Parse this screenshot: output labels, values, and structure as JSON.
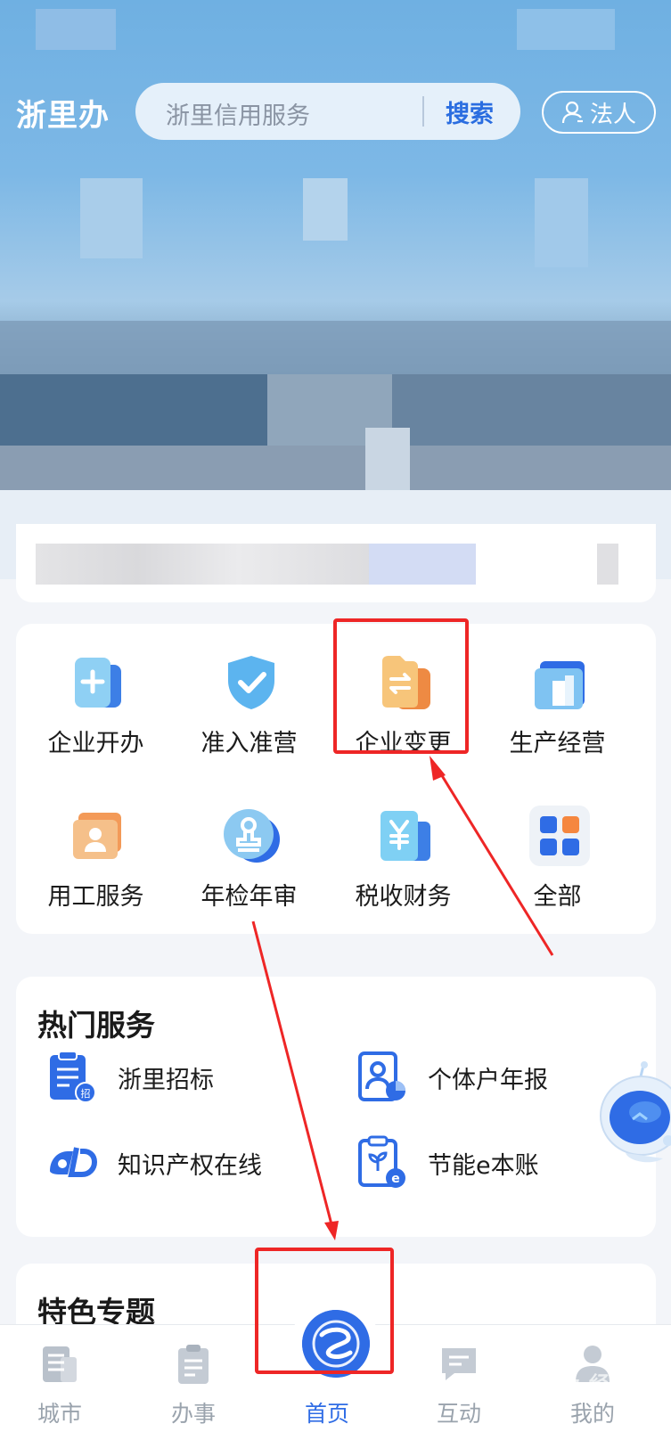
{
  "header": {
    "app_title": "浙里办",
    "search_placeholder": "浙里信用服务",
    "search_button": "搜索",
    "role_button": "法人"
  },
  "services_grid": [
    {
      "label": "企业开办",
      "icon": "enterprise-open-icon"
    },
    {
      "label": "准入准营",
      "icon": "shield-check-icon"
    },
    {
      "label": "企业变更",
      "icon": "enterprise-change-icon"
    },
    {
      "label": "生产经营",
      "icon": "building-icon"
    },
    {
      "label": "用工服务",
      "icon": "employee-card-icon"
    },
    {
      "label": "年检年审",
      "icon": "stamp-icon"
    },
    {
      "label": "税收财务",
      "icon": "yuan-icon"
    },
    {
      "label": "全部",
      "icon": "grid-apps-icon"
    }
  ],
  "hot_services": {
    "title": "热门服务",
    "items": [
      {
        "label": "浙里招标",
        "icon": "bidding-doc-icon"
      },
      {
        "label": "个体户年报",
        "icon": "annual-report-icon"
      },
      {
        "label": "知识产权在线",
        "icon": "ip-logo-icon"
      },
      {
        "label": "节能e本账",
        "icon": "energy-ledger-icon"
      }
    ]
  },
  "featured": {
    "title": "特色专题"
  },
  "tabbar": [
    {
      "label": "城市",
      "icon": "city-icon"
    },
    {
      "label": "办事",
      "icon": "clipboard-icon"
    },
    {
      "label": "首页",
      "icon": "home-logo-icon"
    },
    {
      "label": "互动",
      "icon": "chat-icon"
    },
    {
      "label": "我的",
      "icon": "user-icon"
    }
  ],
  "watermark": "Baidu 经验",
  "colors": {
    "accent": "#2f6ce5",
    "annotation": "#ee2626"
  }
}
